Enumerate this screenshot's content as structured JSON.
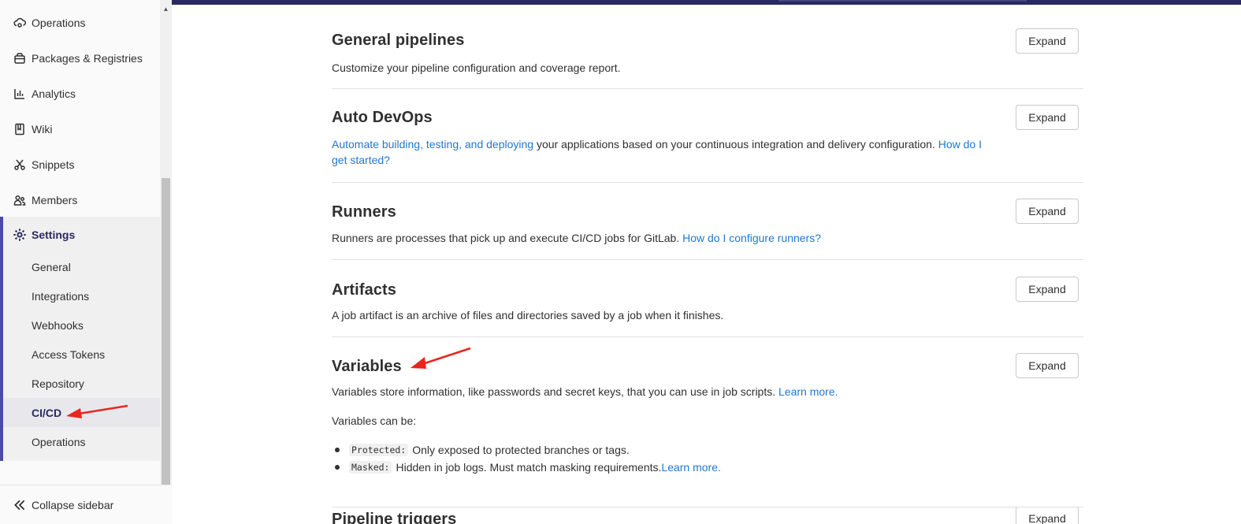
{
  "sidebar": {
    "items": [
      {
        "label": "Operations",
        "icon": "cloud-gear-icon"
      },
      {
        "label": "Packages & Registries",
        "icon": "package-icon"
      },
      {
        "label": "Analytics",
        "icon": "chart-icon"
      },
      {
        "label": "Wiki",
        "icon": "book-icon"
      },
      {
        "label": "Snippets",
        "icon": "scissors-icon"
      },
      {
        "label": "Members",
        "icon": "users-icon"
      }
    ],
    "settings": {
      "label": "Settings",
      "icon": "gear-icon",
      "subitems": [
        {
          "label": "General"
        },
        {
          "label": "Integrations"
        },
        {
          "label": "Webhooks"
        },
        {
          "label": "Access Tokens"
        },
        {
          "label": "Repository"
        },
        {
          "label": "CI/CD",
          "active": true
        },
        {
          "label": "Operations"
        }
      ]
    },
    "collapse_label": "Collapse sidebar"
  },
  "sections": {
    "general_pipelines": {
      "title": "General pipelines",
      "desc": "Customize your pipeline configuration and coverage report.",
      "button": "Expand"
    },
    "auto_devops": {
      "title": "Auto DevOps",
      "link1": "Automate building, testing, and deploying",
      "desc": " your applications based on your continuous integration and delivery configuration. ",
      "link2": "How do I get started?",
      "button": "Expand"
    },
    "runners": {
      "title": "Runners",
      "desc": "Runners are processes that pick up and execute CI/CD jobs for GitLab. ",
      "link": "How do I configure runners?",
      "button": "Expand"
    },
    "artifacts": {
      "title": "Artifacts",
      "desc": "A job artifact is an archive of files and directories saved by a job when it finishes.",
      "button": "Expand"
    },
    "variables": {
      "title": "Variables",
      "desc": "Variables store information, like passwords and secret keys, that you can use in job scripts. ",
      "link": "Learn more.",
      "can_be": "Variables can be:",
      "bullets": [
        {
          "code": "Protected:",
          "text": " Only exposed to protected branches or tags."
        },
        {
          "code": "Masked:",
          "text": " Hidden in job logs. Must match masking requirements. ",
          "link": "Learn more."
        }
      ],
      "button": "Expand"
    },
    "pipeline_triggers": {
      "title": "Pipeline triggers",
      "button": "Expand"
    }
  },
  "colors": {
    "accent": "#292961",
    "link": "#1f78d1",
    "annotation_arrow": "#e8251e"
  }
}
